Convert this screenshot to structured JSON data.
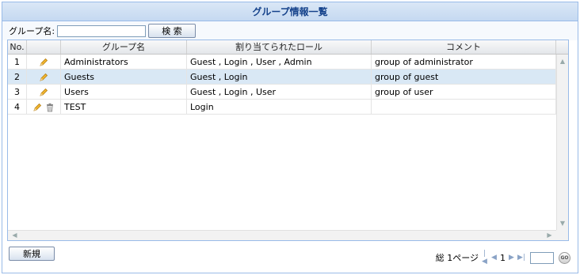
{
  "header": {
    "title": "グループ情報一覧"
  },
  "search": {
    "label": "グループ名:",
    "value": "",
    "button_label": "検 索"
  },
  "grid": {
    "columns": [
      "No.",
      "",
      "グループ名",
      "割り当てられたロール",
      "コメント"
    ],
    "rows": [
      {
        "no": "1",
        "name": "Administrators",
        "roles": "Guest , Login , User , Admin",
        "comment": "group of administrator",
        "icons": [
          "pencil-icon"
        ]
      },
      {
        "no": "2",
        "name": "Guests",
        "roles": "Guest , Login",
        "comment": "group of guest",
        "icons": [
          "pencil-icon"
        ],
        "selected": true
      },
      {
        "no": "3",
        "name": "Users",
        "roles": "Guest , Login , User",
        "comment": "group of user",
        "icons": [
          "pencil-icon"
        ]
      },
      {
        "no": "4",
        "name": "TEST",
        "roles": "Login",
        "comment": "",
        "icons": [
          "pencil-icon",
          "trash-icon"
        ]
      }
    ]
  },
  "footer": {
    "new_button_label": "新規",
    "pager": {
      "total_label": "総 1ページ",
      "current_page": "1",
      "go_label": "GO"
    }
  },
  "colors": {
    "header_text": "#15428b",
    "border": "#99bbe8",
    "selected_row": "#d9e8f5"
  }
}
